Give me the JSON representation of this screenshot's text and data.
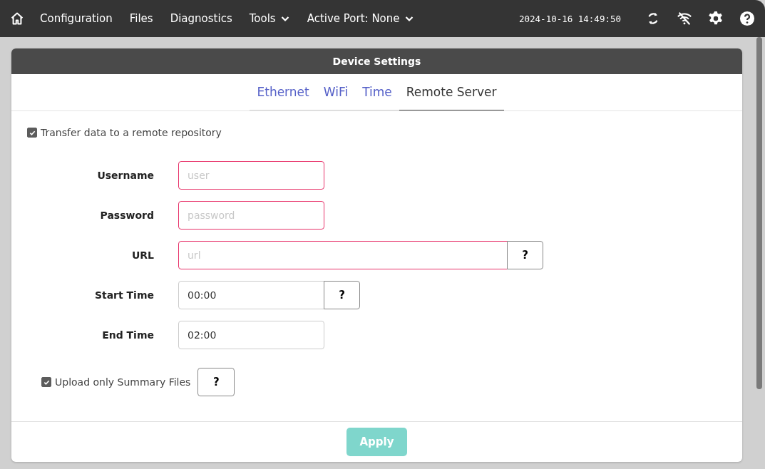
{
  "nav": {
    "items": [
      {
        "label": "Configuration",
        "kind": "link"
      },
      {
        "label": "Files",
        "kind": "link"
      },
      {
        "label": "Diagnostics",
        "kind": "link"
      },
      {
        "label": "Tools",
        "kind": "dropdown"
      },
      {
        "label": "Active Port: None",
        "kind": "dropdown"
      }
    ],
    "datetime": "2024-10-16 14:49:50"
  },
  "panel": {
    "title": "Device Settings",
    "tabs": [
      {
        "label": "Ethernet",
        "selected": false
      },
      {
        "label": "WiFi",
        "selected": false
      },
      {
        "label": "Time",
        "selected": false
      },
      {
        "label": "Remote Server",
        "selected": true
      }
    ],
    "transfer": {
      "label": "Transfer data to a remote repository",
      "checked": true
    },
    "fields": [
      {
        "label": "Username",
        "placeholder": "user",
        "invalid": true,
        "kind": "text"
      },
      {
        "label": "Password",
        "placeholder": "password",
        "invalid": true,
        "kind": "password"
      },
      {
        "label": "URL",
        "placeholder": "url",
        "invalid": true,
        "kind": "url",
        "help": "?"
      },
      {
        "label": "Start Time",
        "value": "00:00",
        "invalid": false,
        "kind": "time",
        "help": "?"
      },
      {
        "label": "End Time",
        "value": "02:00",
        "invalid": false,
        "kind": "time"
      }
    ],
    "summary": {
      "label": "Upload only Summary Files",
      "checked": true,
      "help": "?"
    },
    "apply": {
      "label": "Apply",
      "disabled": true
    }
  }
}
